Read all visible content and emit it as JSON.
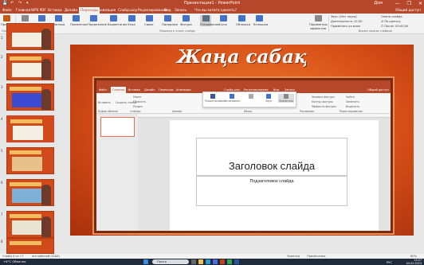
{
  "titlebar": {
    "title": "Презентация1 - PowerPoint",
    "search_placeholder": "Что вы хотите сделать?",
    "user": "Дом",
    "controls": [
      "—",
      "❐",
      "✕"
    ]
  },
  "tabs": [
    "Файл",
    "Главная",
    "WPS PDF",
    "Вставка",
    "Дизайн",
    "Переходы",
    "Анимация",
    "Слайд-шоу",
    "Рецензирование",
    "Вид",
    "Запись"
  ],
  "tabs_active": "Переходы",
  "tabs_right": "Общий доступ",
  "ribbon": {
    "preview_label": "Просмотр",
    "transitions": [
      "Нет",
      "Сдвиг",
      "Наплыв",
      "Появление",
      "Прорезание",
      "Выцветание",
      "Уход",
      "Сдвиг",
      "Панорама",
      "Фигура",
      "Открывание",
      "Соты",
      "Обложка",
      "Вспышка"
    ],
    "effects_label": "Параметры эффектов",
    "group_preview": "Просмотр",
    "group_transition": "Переход к этому слайду",
    "group_timing": "Время показа слайдов",
    "sound": "Звук:",
    "sound_value": "[Нет звука]",
    "duration": "Длительность:",
    "duration_value": "02,00",
    "apply_all": "Применить ко всем",
    "advance": "Смена слайда",
    "on_click": "По щелчку",
    "after": "После:",
    "after_value": "00:00,00"
  },
  "thumbnails": [
    {
      "num": "1"
    },
    {
      "num": "2"
    },
    {
      "num": "3"
    },
    {
      "num": "4"
    },
    {
      "num": "5"
    },
    {
      "num": "6"
    },
    {
      "num": "7"
    },
    {
      "num": "8"
    }
  ],
  "slide": {
    "title": "Жаңа сабақ"
  },
  "inner": {
    "tabs": [
      "Файл",
      "Главная",
      "Вставка",
      "Дизайн",
      "Переходы",
      "Анимация",
      "Слайд-шоу",
      "Рецензирование",
      "Вид",
      "Запись"
    ],
    "active_tab": "Главная",
    "share": "Общий доступ",
    "ribbon_labels": [
      "Вставить",
      "Создать слайд",
      "Макет",
      "Сбросить",
      "Раздел",
      "Найти",
      "Заменить",
      "Выделить",
      "Заливка фигуры",
      "Контур фигуры",
      "Эффекты фигуры"
    ],
    "group_labels": [
      "Буфер обмена",
      "Слайды",
      "Шрифт",
      "Абзац",
      "Рисование",
      "Редактирование"
    ],
    "recorder": [
      "Приостановить",
      "Остановить",
      "",
      "Звук",
      "Указатель"
    ],
    "title_placeholder": "Заголовок слайда",
    "subtitle_placeholder": "Подзаголовок слайда"
  },
  "status": {
    "slide": "Слайд 4 из 17",
    "language": "английский (США)",
    "notes": "Заметки",
    "comments": "Примечания",
    "zoom": "60%"
  },
  "taskbar": {
    "weather": "+6°C",
    "weather_sub": "Облачно",
    "search": "Поиск",
    "lang": "РУС",
    "time": "13:07",
    "date": "04.02.2023"
  },
  "colors": {
    "accent": "#b7472a",
    "slide_bg": "#d54d17"
  }
}
